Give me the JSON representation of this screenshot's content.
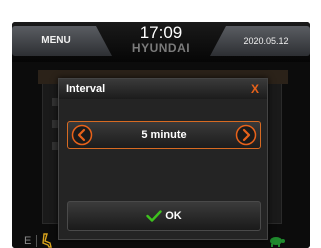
{
  "header": {
    "menu_label": "MENU",
    "time": "17:09",
    "brand": "HYUNDAI",
    "date": "2020.05.12"
  },
  "dialog": {
    "title": "Interval",
    "close_label": "X",
    "value": "5 minute",
    "prev_icon": "chevron-left-icon",
    "next_icon": "chevron-right-icon",
    "ok_label": "OK",
    "ok_icon": "check-icon"
  },
  "footer": {
    "left_text": "E"
  },
  "colors": {
    "accent": "#e8621a",
    "ok_check": "#3ec21e",
    "background": "#0c0c0c"
  }
}
